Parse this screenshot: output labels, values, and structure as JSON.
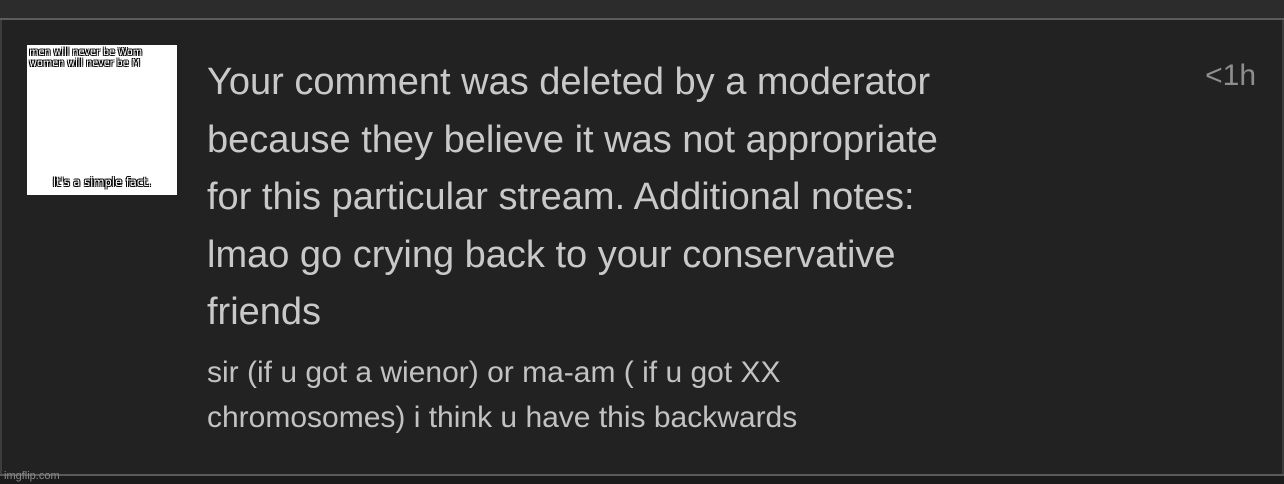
{
  "avatar": {
    "line1": "ns men will never be Wom",
    "line2": "ns women will never be M",
    "caption": "It's a simple fact."
  },
  "notice": {
    "text": "Your comment was deleted by a moderator\nbecause they believe it was not appropriate\nfor this particular stream. Additional notes:\nlmao go crying back to your conservative\nfriends",
    "timestamp": "<1h"
  },
  "comment": {
    "text": "sir (if u got a wienor) or ma-am ( if u got XX\nchromosomes) i think u have this backwards"
  },
  "watermark": "imgflip.com"
}
